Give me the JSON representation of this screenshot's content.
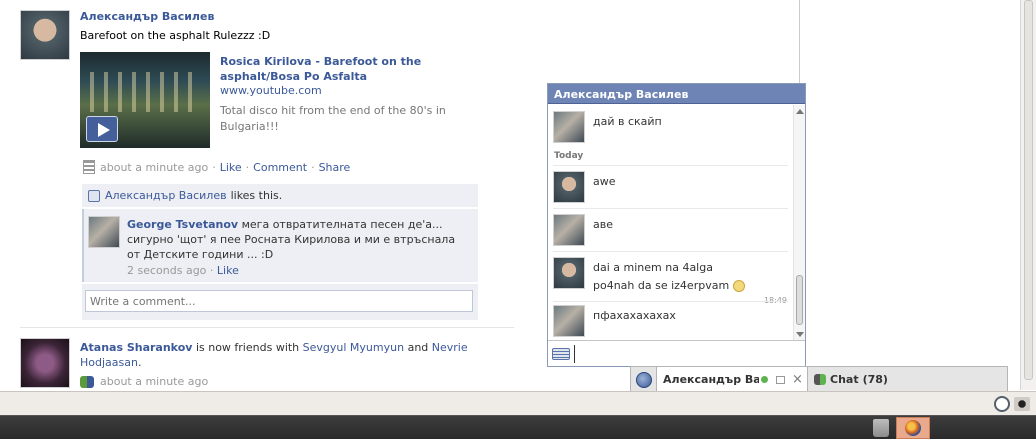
{
  "feed": {
    "story1": {
      "author": "Александър Василев",
      "text": "Barefoot on the asphalt Rulezzz :D",
      "link_title": "Rosica Kirilova - Barefoot on the asphalt/Bosa Po Asfalta",
      "link_url": "www.youtube.com",
      "link_desc": "Total disco hit from the end of the 80's in Bulgaria!!!",
      "time": "about a minute ago",
      "actions": [
        "Like",
        "Comment",
        "Share"
      ],
      "likes_name": "Александър Василев",
      "likes_suffix": "likes this.",
      "comment": {
        "author": "George Tsvetanov",
        "text": "мега отвратителната песен де'а... сигурно 'щот' я пее Росната Кирилова и ми е втръснала от Детските години ... :D",
        "time": "2 seconds ago",
        "like": "Like"
      },
      "write_placeholder": "Write a comment..."
    },
    "story2": {
      "author": "Atanas Sharankov",
      "mid": "is now friends with",
      "friend1": "Sevgyul Myumyun",
      "and": "and",
      "friend2": "Nevrie Hodjaasan",
      "time": "about a minute ago"
    }
  },
  "chat_window": {
    "title": "Александър Василев",
    "msg1": "дай в скайп",
    "today": "Today",
    "msg2": "awe",
    "msg3": "аве",
    "msg4_line1": "dai a minem na 4alga",
    "msg4_line2": "po4nah da se iz4erpvam",
    "time": "18:49",
    "msg5": "пфахахахахах"
  },
  "chat_bar": {
    "tab_name": "Александър Ва",
    "chat_label": "Chat",
    "chat_count": "(78)"
  }
}
